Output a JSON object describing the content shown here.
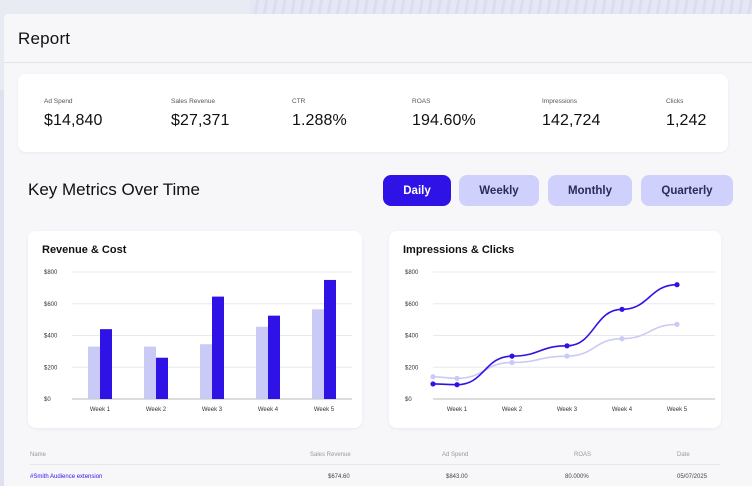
{
  "page": {
    "title": "Report"
  },
  "stats": [
    {
      "label": "Ad Spend",
      "value": "$14,840"
    },
    {
      "label": "Sales Revenue",
      "value": "$27,371"
    },
    {
      "label": "CTR",
      "value": "1.288%"
    },
    {
      "label": "ROAS",
      "value": "194.60%"
    },
    {
      "label": "Impressions",
      "value": "142,724"
    },
    {
      "label": "Clicks",
      "value": "1,242"
    }
  ],
  "section": {
    "title": "Key Metrics Over Time"
  },
  "tabs": [
    {
      "label": "Daily",
      "active": true
    },
    {
      "label": "Weekly",
      "active": false
    },
    {
      "label": "Monthly",
      "active": false
    },
    {
      "label": "Quarterly",
      "active": false
    }
  ],
  "colors": {
    "accent": "#2e12e6",
    "accent_light": "#cfd0fb",
    "bar_light": "#c9caf6",
    "line_light": "#c9caf6"
  },
  "chart_data": [
    {
      "type": "bar",
      "title": "Revenue & Cost",
      "categories": [
        "Week 1",
        "Week 2",
        "Week 3",
        "Week 4",
        "Week 5"
      ],
      "y_ticks": [
        "$800",
        "$600",
        "$400",
        "$200",
        "$0"
      ],
      "ylim": [
        0,
        800
      ],
      "series": [
        {
          "values": [
            330,
            330,
            345,
            455,
            565
          ],
          "color": "#c9caf6"
        },
        {
          "values": [
            440,
            260,
            645,
            525,
            750
          ],
          "color": "#2e12e6"
        }
      ],
      "grid": true
    },
    {
      "type": "line",
      "title": "Impressions & Clicks",
      "x": [
        "Week 1",
        "Week 2",
        "Week 3",
        "Week 4",
        "Week 5"
      ],
      "y_ticks": [
        "$800",
        "$600",
        "$400",
        "$200",
        "$0"
      ],
      "ylim": [
        0,
        800
      ],
      "series": [
        {
          "values": [
            90,
            270,
            335,
            565,
            720
          ],
          "color": "#2e12e6",
          "start_value": 95
        },
        {
          "values": [
            130,
            230,
            270,
            380,
            470
          ],
          "color": "#c9caf6",
          "start_value": 140
        }
      ],
      "grid": true
    }
  ],
  "table": {
    "columns": [
      "Name",
      "Sales Revenue",
      "Ad Spend",
      "ROAS",
      "Date"
    ],
    "rows": [
      [
        "#Smith Audience extension",
        "$674.60",
        "$843.00",
        "80.000%",
        "05/07/2025"
      ]
    ]
  }
}
